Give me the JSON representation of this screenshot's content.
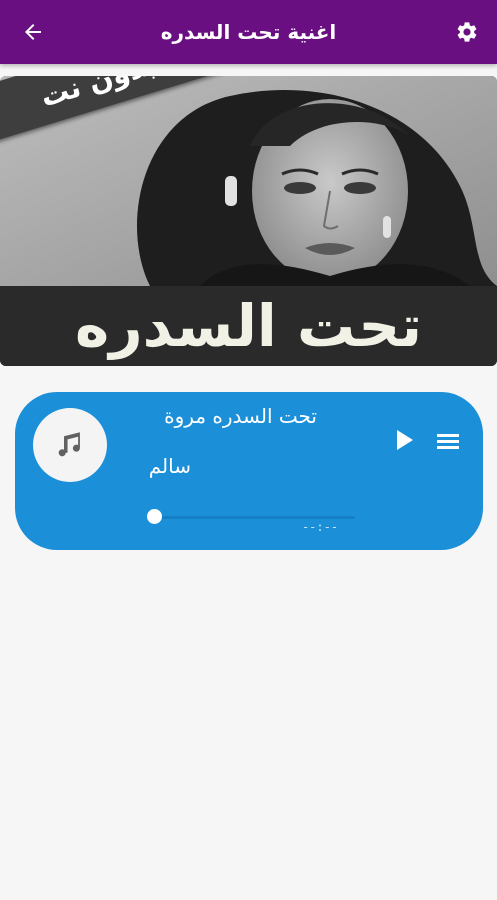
{
  "app_bar": {
    "title": "اغنية تحت السدره",
    "background_color": "#6a0f82",
    "back_icon": "arrow-left-icon",
    "settings_icon": "gear-icon"
  },
  "banner": {
    "ribbon_text": "بدون نت",
    "caption": "تحت السدره"
  },
  "player": {
    "song_title": "تحت السدره مروة",
    "artist": "سالم",
    "time": "--:--",
    "progress": 0,
    "album_icon": "music-note-icon",
    "play_icon": "play-icon",
    "menu_icon": "menu-icon",
    "card_color": "#1c8fd9"
  }
}
